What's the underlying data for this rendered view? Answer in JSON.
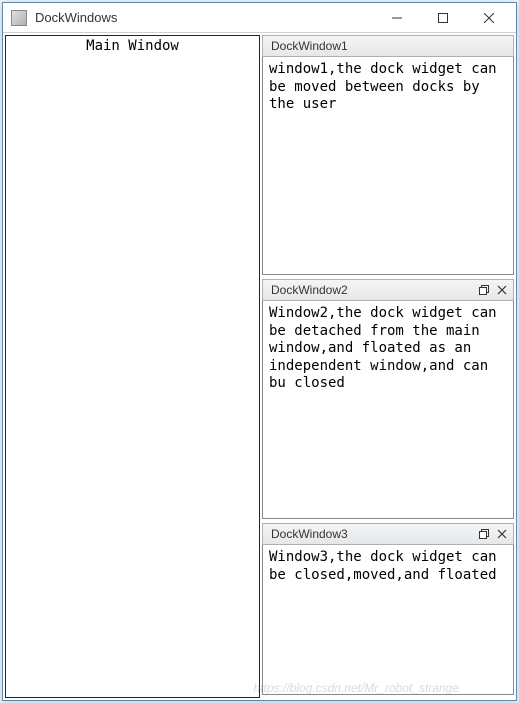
{
  "window": {
    "title": "DockWindows"
  },
  "main_panel": {
    "label": "Main Window"
  },
  "docks": [
    {
      "title": "DockWindow1",
      "has_float": false,
      "has_close": false,
      "content": "window1,the dock widget can be moved between docks by the user"
    },
    {
      "title": "DockWindow2",
      "has_float": true,
      "has_close": true,
      "content": "Window2,the dock widget can be detached from the main window,and floated as an independent window,and can bu closed"
    },
    {
      "title": "DockWindow3",
      "has_float": true,
      "has_close": true,
      "content": "Window3,the dock widget can be closed,moved,and floated"
    }
  ],
  "watermark": "https://blog.csdn.net/Mr_robot_strange"
}
